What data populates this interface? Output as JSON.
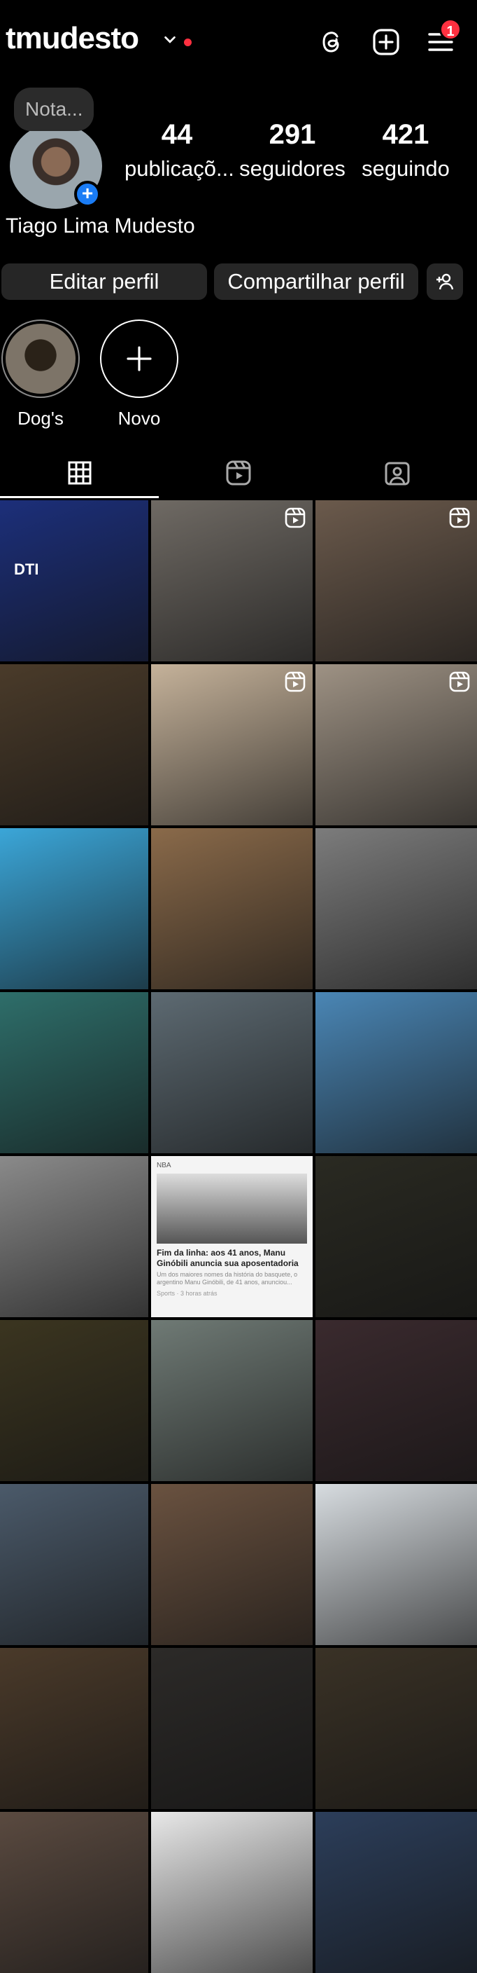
{
  "header": {
    "username": "tmudesto",
    "notification_count": "1",
    "icons": [
      "chevron-down-icon",
      "threads-icon",
      "create-post-icon",
      "menu-icon"
    ]
  },
  "profile": {
    "note": "Nota...",
    "full_name": "Tiago Lima Mudesto",
    "stats": [
      {
        "value": "44",
        "label": "publicaçõ..."
      },
      {
        "value": "291",
        "label": "seguidores"
      },
      {
        "value": "421",
        "label": "seguindo"
      }
    ]
  },
  "actions": {
    "edit": "Editar perfil",
    "share": "Compartilhar perfil"
  },
  "highlights": [
    {
      "label": "Dog's"
    },
    {
      "label": "Novo"
    }
  ],
  "tabs": [
    "grid-icon",
    "reels-icon",
    "tagged-icon"
  ],
  "posts": [
    {
      "theme": "#1c2f7a",
      "reel": false,
      "text": "DTI"
    },
    {
      "theme": "#6f6a64",
      "reel": true
    },
    {
      "theme": "#6b5a4c",
      "reel": true
    },
    {
      "theme": "#4a3b2a",
      "reel": false
    },
    {
      "theme": "#c5b29a",
      "reel": true
    },
    {
      "theme": "#9e9284",
      "reel": true
    },
    {
      "theme": "#3ba6d8",
      "reel": false
    },
    {
      "theme": "#8a6a4a",
      "reel": false
    },
    {
      "theme": "#7c7c7c",
      "reel": false
    },
    {
      "theme": "#2e6e6a",
      "reel": false
    },
    {
      "theme": "#5d6a72",
      "reel": false
    },
    {
      "theme": "#4a86b5",
      "reel": false
    },
    {
      "theme": "#8a8a8a",
      "reel": false
    },
    {
      "theme": "#f2f2f2",
      "reel": false,
      "news": {
        "source": "NBA",
        "headline": "Fim da linha: aos 41 anos, Manu Ginóbili anuncia sua aposentadoria",
        "snippet": "Um dos maiores nomes da história do basquete, o argentino Manu Ginóbili, de 41 anos, anunciou...",
        "footer": "Sports · 3 horas atrás"
      }
    },
    {
      "theme": "#2a2a22",
      "reel": false
    },
    {
      "theme": "#3b3520",
      "reel": false
    },
    {
      "theme": "#6f7a75",
      "reel": false
    },
    {
      "theme": "#3a2a2e",
      "reel": false
    },
    {
      "theme": "#4b5a6a",
      "reel": false
    },
    {
      "theme": "#6a5240",
      "reel": false
    },
    {
      "theme": "#d7dce0",
      "reel": false
    },
    {
      "theme": "#4a3a2a",
      "reel": false
    },
    {
      "theme": "#2c2a28",
      "reel": false
    },
    {
      "theme": "#3a3226",
      "reel": false
    },
    {
      "theme": "#5a4a40",
      "reel": false
    },
    {
      "theme": "#e8e8e8",
      "reel": false
    },
    {
      "theme": "#2c3e5a",
      "reel": false
    }
  ]
}
